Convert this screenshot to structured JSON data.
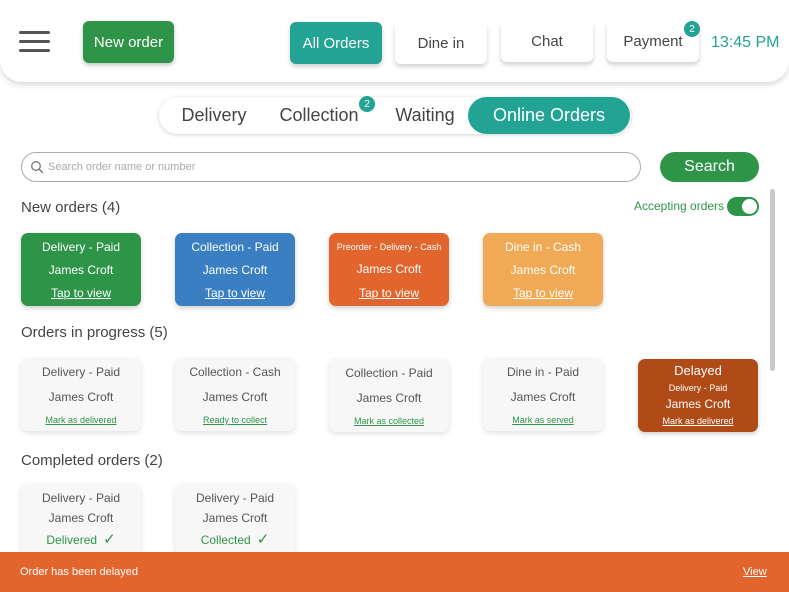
{
  "header": {
    "new_order_label": "New order",
    "tabs": [
      {
        "label": "All Orders",
        "active": true
      },
      {
        "label": "Dine in",
        "active": false
      },
      {
        "label": "Chat",
        "active": false
      },
      {
        "label": "Payment",
        "active": false,
        "badge": "2"
      }
    ],
    "time": "13:45 PM"
  },
  "filters": {
    "tabs": [
      {
        "label": "Delivery",
        "active": false
      },
      {
        "label": "Collection",
        "active": false,
        "badge": "2"
      },
      {
        "label": "Waiting",
        "active": false
      },
      {
        "label": "Online Orders",
        "active": true
      }
    ]
  },
  "search": {
    "placeholder": "Search order name or number",
    "button_label": "Search"
  },
  "new_orders": {
    "title": "New orders (4)",
    "accepting_label": "Accepting orders",
    "accepting_on": true,
    "cards": [
      {
        "type": "Delivery - Paid",
        "name": "James Croft",
        "action": "Tap to view",
        "color": "#2e9447"
      },
      {
        "type": "Collection - Paid",
        "name": "James Croft",
        "action": "Tap to view",
        "color": "#3a7fc1"
      },
      {
        "type": "Preorder - Delivery - Cash",
        "name": "James Croft",
        "action": "Tap to view",
        "color": "#e2652d"
      },
      {
        "type": "Dine in - Cash",
        "name": "James Croft",
        "action": "Tap to view",
        "color": "#f0a955"
      }
    ]
  },
  "in_progress": {
    "title": "Orders in progress (5)",
    "cards": [
      {
        "type": "Delivery - Paid",
        "name": "James Croft",
        "action": "Mark as delivered"
      },
      {
        "type": "Collection - Cash",
        "name": "James Croft",
        "action": "Ready to collect"
      },
      {
        "type": "Collection - Paid",
        "name": "James Croft",
        "action": "Mark as collected"
      },
      {
        "type": "Dine in - Paid",
        "name": "James Croft",
        "action": "Mark as served"
      },
      {
        "status": "Delayed",
        "type": "Delivery - Paid",
        "name": "James Croft",
        "action": "Mark as delivered",
        "color": "#b04a16"
      }
    ]
  },
  "completed": {
    "title": "Completed orders (2)",
    "cards": [
      {
        "type": "Delivery - Paid",
        "name": "James Croft",
        "status": "Delivered"
      },
      {
        "type": "Delivery - Paid",
        "name": "James Croft",
        "status": "Collected"
      }
    ]
  },
  "banner": {
    "message": "Order has been delayed",
    "action": "View",
    "color": "#e2652d"
  },
  "colors": {
    "accent": "#22a393",
    "brand_green": "#2e9447"
  }
}
